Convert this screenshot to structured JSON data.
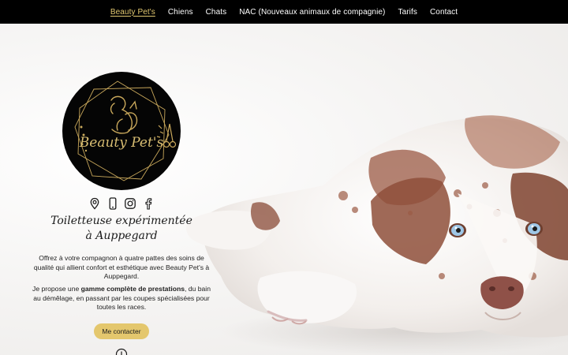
{
  "nav": {
    "items": [
      {
        "label": "Beauty Pet's",
        "active": true
      },
      {
        "label": "Chiens"
      },
      {
        "label": "Chats"
      },
      {
        "label": "NAC (Nouveaux animaux de compagnie)"
      },
      {
        "label": "Tarifs"
      },
      {
        "label": "Contact"
      }
    ]
  },
  "hero": {
    "logo_text": "Beauty Pet's",
    "social_icons": [
      "location-pin-icon",
      "phone-icon",
      "instagram-icon",
      "facebook-icon"
    ],
    "tagline": "Toiletteuse expérimentée à Auppegard",
    "paragraph1": "Offrez à votre compagnon à quatre pattes des soins de qualité qui allient confort et esthétique avec Beauty Pet's à Auppegard.",
    "paragraph2_prefix": "Je propose une ",
    "paragraph2_bold": "gamme complète de prestations",
    "paragraph2_suffix": ", du bain au démêlage, en passant par les coupes spécialisées pour toutes les races.",
    "cta_label": "Me contacter",
    "scroll_icon": "mouse-scroll-icon"
  },
  "colors": {
    "accent": "#e2c870",
    "button": "#e4c76d",
    "nav_bg": "#000000",
    "logo_bg": "#050505"
  }
}
